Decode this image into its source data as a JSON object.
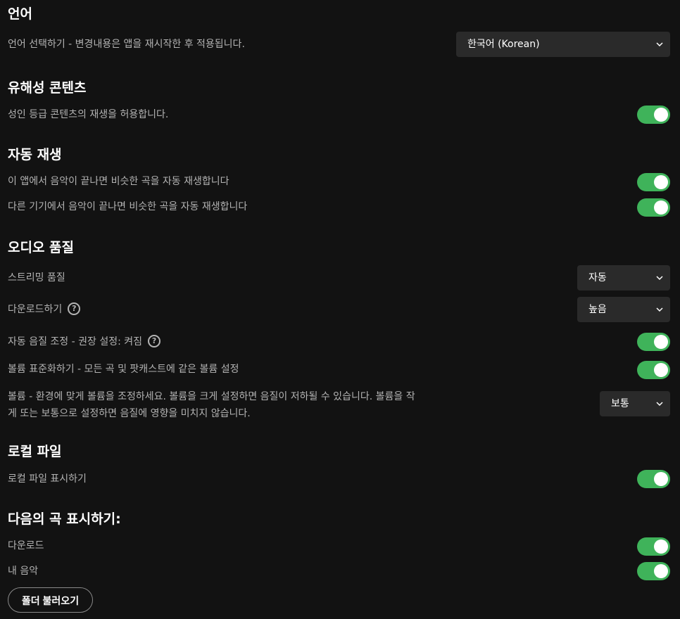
{
  "sections": {
    "language": {
      "title": "언어",
      "label": "언어 선택하기 - 변경내용은 앱을 재시작한 후 적용됩니다.",
      "select_value": "한국어 (Korean)"
    },
    "explicit": {
      "title": "유해성 콘텐츠",
      "label": "성인 등급 콘텐츠의 재생을 허용합니다.",
      "toggle_on": true
    },
    "autoplay": {
      "title": "자동 재생",
      "item1": "이 앱에서 음악이 끝나면 비슷한 곡을 자동 재생합니다",
      "item2": "다른 기기에서 음악이 끝나면 비슷한 곡을 자동 재생합니다",
      "toggle1_on": true,
      "toggle2_on": true
    },
    "audio": {
      "title": "오디오 품질",
      "streaming_label": "스트리밍 품질",
      "streaming_value": "자동",
      "download_label": "다운로드하기",
      "download_value": "높음",
      "auto_adjust_label": "자동 음질 조정 - 권장 설정: 켜짐",
      "normalize_label": "볼륨 표준화하기 - 모든 곡 및 팟캐스트에 같은 볼륨 설정",
      "volume_label_line1": "볼륨 - 환경에 맞게 볼륨을 조정하세요. 볼륨을 크게 설정하면 음질이 저하될 수 있습니다. 볼륨을 작",
      "volume_label_line2": "게 또는 보통으로 설정하면 음질에 영향을 미치지 않습니다.",
      "volume_value": "보통",
      "help_glyph": "?"
    },
    "local": {
      "title": "로컬 파일",
      "label": "로컬 파일 표시하기"
    },
    "show_songs": {
      "title": "다음의 곡 표시하기:",
      "downloads_label": "다운로드",
      "my_music_label": "내 음악",
      "add_folder_button": "폴더 불러오기"
    }
  },
  "colors": {
    "background": "#121212",
    "toggle_on": "#3fb35a",
    "select_bg": "#2a2a2a"
  },
  "icons": [
    "chevron-down-icon",
    "help-icon"
  ]
}
